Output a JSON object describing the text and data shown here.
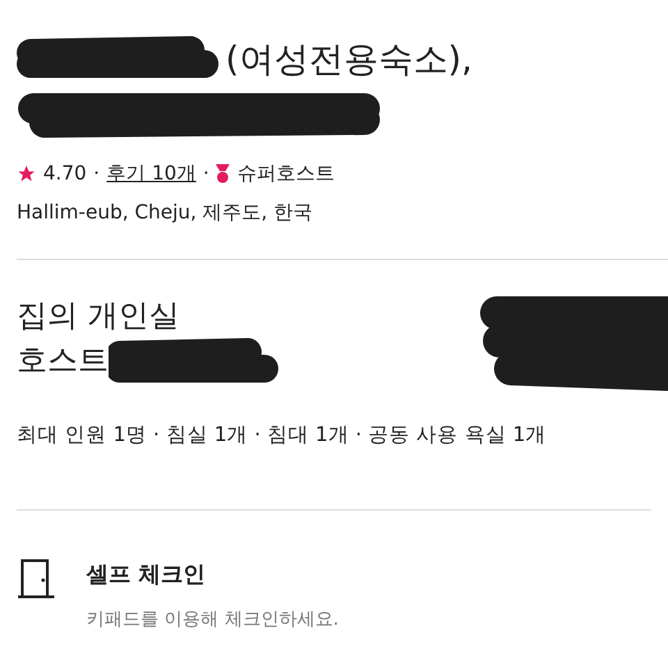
{
  "listing": {
    "title_visible": "(여성전용숙소),",
    "rating": "4.70",
    "separators": [
      "·",
      "·"
    ],
    "reviews": "후기 10개",
    "superhost": "슈퍼호스트",
    "location": "Hallim-eub, Cheju, 제주도, 한국"
  },
  "room": {
    "type": "집의 개인실",
    "host_label": "호스트",
    "details": "최대 인원 1명 · 침실 1개 · 침대 1개 · 공동 사용 욕실 1개"
  },
  "features": [
    {
      "kind": "door",
      "title": "셀프 체크인",
      "subtitle": "키패드를 이용해 체크인하세요."
    }
  ]
}
